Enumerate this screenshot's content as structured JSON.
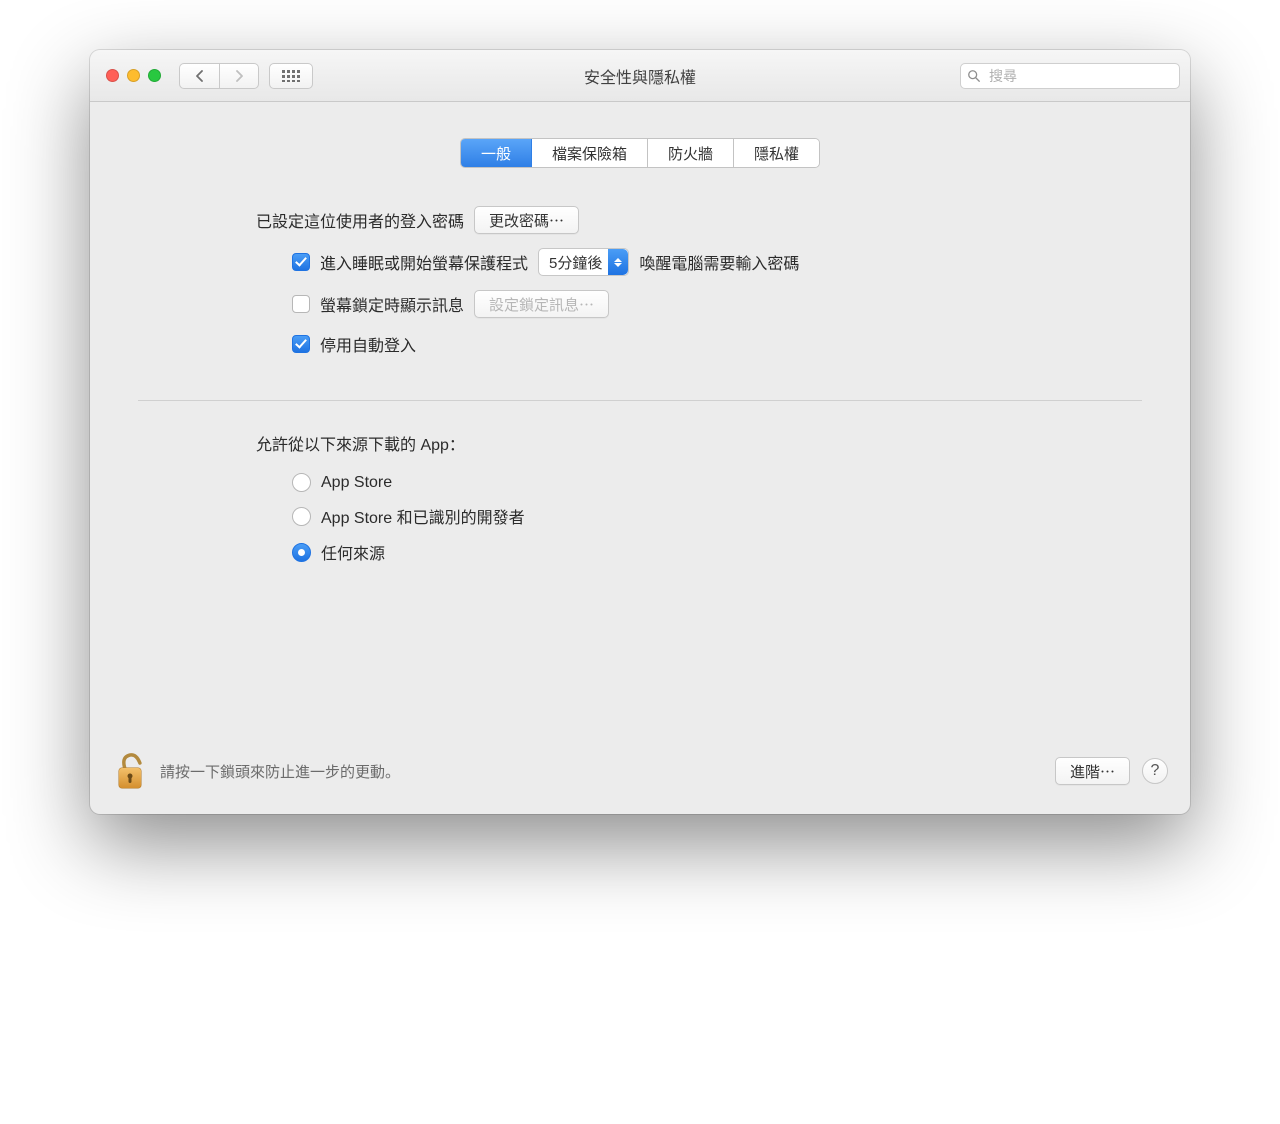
{
  "window": {
    "title": "安全性與隱私權"
  },
  "search": {
    "placeholder": "搜尋"
  },
  "tabs": [
    {
      "label": "一般",
      "active": true
    },
    {
      "label": "檔案保險箱",
      "active": false
    },
    {
      "label": "防火牆",
      "active": false
    },
    {
      "label": "隱私權",
      "active": false
    }
  ],
  "general": {
    "login_pw_label": "已設定這位使用者的登入密碼",
    "change_pw_btn": "更改密碼⋯",
    "require_pw_prefix": "進入睡眠或開始螢幕保護程式",
    "require_pw_delay": "5分鐘後",
    "require_pw_suffix": "喚醒電腦需要輸入密碼",
    "show_lock_msg_label": "螢幕鎖定時顯示訊息",
    "set_lock_msg_btn": "設定鎖定訊息⋯",
    "disable_autologin_label": "停用自動登入",
    "download_from_label": "允許從以下來源下載的 App：",
    "sources": [
      {
        "label": "App Store",
        "selected": false
      },
      {
        "label": "App Store 和已識別的開發者",
        "selected": false
      },
      {
        "label": "任何來源",
        "selected": true
      }
    ]
  },
  "footer": {
    "lock_text": "請按一下鎖頭來防止進一步的更動。",
    "advanced_btn": "進階⋯",
    "help": "?"
  }
}
